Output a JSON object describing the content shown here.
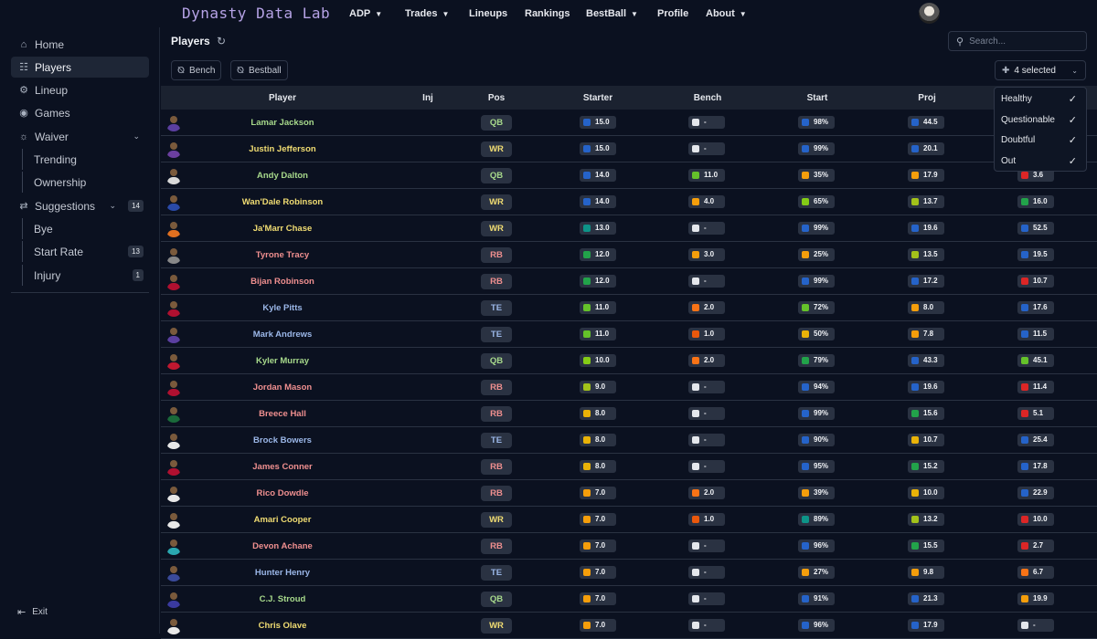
{
  "app": {
    "logo": "Dynasty Data Lab",
    "nav": [
      {
        "label": "ADP",
        "dropdown": true
      },
      {
        "label": "Trades",
        "dropdown": true
      },
      {
        "label": "Lineups",
        "dropdown": false
      },
      {
        "label": "Rankings",
        "dropdown": false
      },
      {
        "label": "BestBall",
        "dropdown": true
      },
      {
        "label": "Profile",
        "dropdown": false
      },
      {
        "label": "About",
        "dropdown": true
      }
    ]
  },
  "sidebar": {
    "items": [
      {
        "label": "Home",
        "icon": "home-icon"
      },
      {
        "label": "Players",
        "icon": "players-icon",
        "active": true
      },
      {
        "label": "Lineup",
        "icon": "lineup-icon"
      },
      {
        "label": "Games",
        "icon": "football-icon"
      },
      {
        "label": "Waiver",
        "icon": "waiver-icon"
      },
      {
        "label": "Trending"
      },
      {
        "label": "Ownership"
      },
      {
        "label": "Suggestions",
        "icon": "suggestions-icon",
        "badge": "14"
      },
      {
        "label": "Bye"
      },
      {
        "label": "Start Rate",
        "badge": "13"
      },
      {
        "label": "Injury",
        "badge": "1"
      }
    ],
    "exit": "Exit"
  },
  "page": {
    "title": "Players",
    "search_placeholder": "Search...",
    "filters": [
      "Bench",
      "Bestball"
    ],
    "injury_select": "4 selected",
    "injury_options": [
      "Healthy",
      "Questionable",
      "Doubtful",
      "Out"
    ]
  },
  "table": {
    "columns": [
      "Player",
      "Inj",
      "Pos",
      "Starter",
      "Bench",
      "Start",
      "Proj"
    ],
    "rows": [
      {
        "name": "Lamar Jackson",
        "pos": "QB",
        "starter": "15.0",
        "bench": "-",
        "start": "98%",
        "proj": "44.5",
        "last": "",
        "c": [
          "#2563c9",
          "#e4e7ec",
          "#2563c9",
          "#2563c9",
          ""
        ]
      },
      {
        "name": "Justin Jefferson",
        "pos": "WR",
        "starter": "15.0",
        "bench": "-",
        "start": "99%",
        "proj": "20.1",
        "last": "",
        "c": [
          "#2563c9",
          "#e4e7ec",
          "#2563c9",
          "#2563c9",
          ""
        ]
      },
      {
        "name": "Andy Dalton",
        "pos": "QB",
        "starter": "14.0",
        "bench": "11.0",
        "start": "35%",
        "proj": "17.9",
        "last": "3.6",
        "c": [
          "#2563c9",
          "#65c22a",
          "#f59e0b",
          "#f59e0b",
          "#dc2626"
        ]
      },
      {
        "name": "Wan'Dale Robinson",
        "pos": "WR",
        "starter": "14.0",
        "bench": "4.0",
        "start": "65%",
        "proj": "13.7",
        "last": "16.0",
        "c": [
          "#2563c9",
          "#f59e0b",
          "#84cc16",
          "#a3c21a",
          "#22a34a"
        ]
      },
      {
        "name": "Ja'Marr Chase",
        "pos": "WR",
        "starter": "13.0",
        "bench": "-",
        "start": "99%",
        "proj": "19.6",
        "last": "52.5",
        "c": [
          "#0d9488",
          "#e4e7ec",
          "#2563c9",
          "#2563c9",
          "#2563c9"
        ]
      },
      {
        "name": "Tyrone Tracy",
        "pos": "RB",
        "starter": "12.0",
        "bench": "3.0",
        "start": "25%",
        "proj": "13.5",
        "last": "19.5",
        "c": [
          "#22a34a",
          "#f59e0b",
          "#f59e0b",
          "#a3c21a",
          "#2563c9"
        ]
      },
      {
        "name": "Bijan Robinson",
        "pos": "RB",
        "starter": "12.0",
        "bench": "-",
        "start": "99%",
        "proj": "17.2",
        "last": "10.7",
        "c": [
          "#22a34a",
          "#e4e7ec",
          "#2563c9",
          "#2563c9",
          "#dc2626"
        ]
      },
      {
        "name": "Kyle Pitts",
        "pos": "TE",
        "starter": "11.0",
        "bench": "2.0",
        "start": "72%",
        "proj": "8.0",
        "last": "17.6",
        "c": [
          "#65c22a",
          "#f97316",
          "#65c22a",
          "#f59e0b",
          "#2563c9"
        ]
      },
      {
        "name": "Mark Andrews",
        "pos": "TE",
        "starter": "11.0",
        "bench": "1.0",
        "start": "50%",
        "proj": "7.8",
        "last": "11.5",
        "c": [
          "#65c22a",
          "#ea580c",
          "#eab308",
          "#f59e0b",
          "#2563c9"
        ]
      },
      {
        "name": "Kyler Murray",
        "pos": "QB",
        "starter": "10.0",
        "bench": "2.0",
        "start": "79%",
        "proj": "43.3",
        "last": "45.1",
        "c": [
          "#84cc16",
          "#f97316",
          "#22a34a",
          "#2563c9",
          "#65c22a"
        ]
      },
      {
        "name": "Jordan Mason",
        "pos": "RB",
        "starter": "9.0",
        "bench": "-",
        "start": "94%",
        "proj": "19.6",
        "last": "11.4",
        "c": [
          "#a3c21a",
          "#e4e7ec",
          "#2563c9",
          "#2563c9",
          "#dc2626"
        ]
      },
      {
        "name": "Breece Hall",
        "pos": "RB",
        "starter": "8.0",
        "bench": "-",
        "start": "99%",
        "proj": "15.6",
        "last": "5.1",
        "c": [
          "#eab308",
          "#e4e7ec",
          "#2563c9",
          "#22a34a",
          "#dc2626"
        ]
      },
      {
        "name": "Brock Bowers",
        "pos": "TE",
        "starter": "8.0",
        "bench": "-",
        "start": "90%",
        "proj": "10.7",
        "last": "25.4",
        "c": [
          "#eab308",
          "#e4e7ec",
          "#2563c9",
          "#eab308",
          "#2563c9"
        ]
      },
      {
        "name": "James Conner",
        "pos": "RB",
        "starter": "8.0",
        "bench": "-",
        "start": "95%",
        "proj": "15.2",
        "last": "17.8",
        "c": [
          "#eab308",
          "#e4e7ec",
          "#2563c9",
          "#22a34a",
          "#2563c9"
        ]
      },
      {
        "name": "Rico Dowdle",
        "pos": "RB",
        "starter": "7.0",
        "bench": "2.0",
        "start": "39%",
        "proj": "10.0",
        "last": "22.9",
        "c": [
          "#f59e0b",
          "#f97316",
          "#f59e0b",
          "#eab308",
          "#2563c9"
        ]
      },
      {
        "name": "Amari Cooper",
        "pos": "WR",
        "starter": "7.0",
        "bench": "1.0",
        "start": "89%",
        "proj": "13.2",
        "last": "10.0",
        "c": [
          "#f59e0b",
          "#ea580c",
          "#0d9488",
          "#a3c21a",
          "#dc2626"
        ]
      },
      {
        "name": "Devon Achane",
        "pos": "RB",
        "starter": "7.0",
        "bench": "-",
        "start": "96%",
        "proj": "15.5",
        "last": "2.7",
        "c": [
          "#f59e0b",
          "#e4e7ec",
          "#2563c9",
          "#22a34a",
          "#dc2626"
        ]
      },
      {
        "name": "Hunter Henry",
        "pos": "TE",
        "starter": "7.0",
        "bench": "-",
        "start": "27%",
        "proj": "9.8",
        "last": "6.7",
        "c": [
          "#f59e0b",
          "#e4e7ec",
          "#f59e0b",
          "#f59e0b",
          "#f97316"
        ]
      },
      {
        "name": "C.J. Stroud",
        "pos": "QB",
        "starter": "7.0",
        "bench": "-",
        "start": "91%",
        "proj": "21.3",
        "last": "19.9",
        "c": [
          "#f59e0b",
          "#e4e7ec",
          "#2563c9",
          "#2563c9",
          "#f59e0b"
        ]
      },
      {
        "name": "Chris Olave",
        "pos": "WR",
        "starter": "7.0",
        "bench": "-",
        "start": "96%",
        "proj": "17.9",
        "last": "-",
        "c": [
          "#f59e0b",
          "#e4e7ec",
          "#2563c9",
          "#2563c9",
          "#e4e7ec"
        ]
      }
    ]
  },
  "colors": {
    "QB": "#a7d98b",
    "WR": "#f0dc72",
    "RB": "#ef8f8f",
    "TE": "#9bb7e8"
  }
}
